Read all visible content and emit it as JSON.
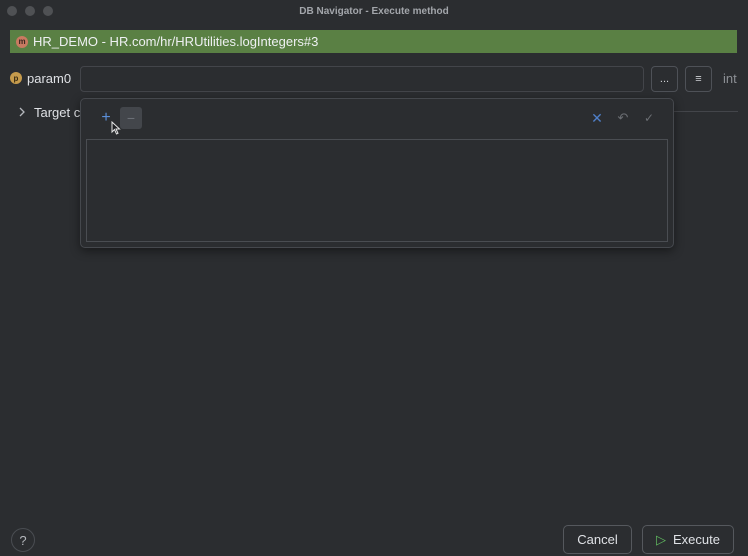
{
  "window": {
    "title": "DB Navigator - Execute method"
  },
  "header": {
    "text": "HR_DEMO - HR.com/hr/HRUtilities.logIntegers#3",
    "icon": "m",
    "color": "#5a8044"
  },
  "param": {
    "icon": "p",
    "label": "param0",
    "value": "",
    "type": "int",
    "more_icon": "...",
    "list_icon": "≡"
  },
  "target": {
    "label": "Target c"
  },
  "popup": {
    "add_icon": "+",
    "remove_icon": "−",
    "cancel_icon": "✕",
    "revert_icon": "↶",
    "confirm_icon": "✓"
  },
  "footer": {
    "help_label": "?",
    "cancel_label": "Cancel",
    "execute_label": "Execute",
    "execute_icon": "▷"
  }
}
